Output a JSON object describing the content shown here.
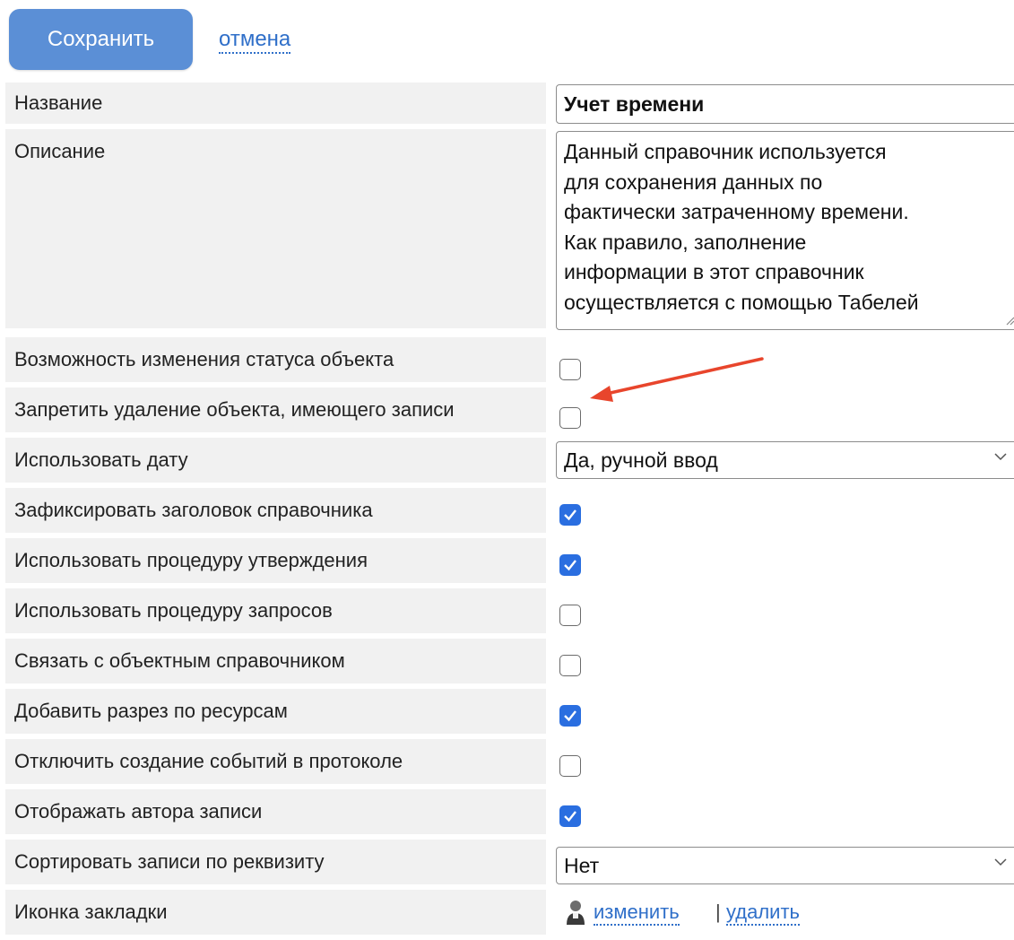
{
  "toolbar": {
    "save_label": "Сохранить",
    "cancel_label": "отмена"
  },
  "fields": {
    "name": {
      "label": "Название",
      "value": "Учет времени"
    },
    "description": {
      "label": "Описание",
      "lines": [
        "Данный справочник используется",
        "для сохранения данных по",
        "фактически затраченному времени.",
        "Как правило, заполнение",
        "информации в этот справочник",
        "осуществляется с помощью Табелей"
      ]
    },
    "status_change": {
      "label": "Возможность изменения статуса объекта",
      "checked": false
    },
    "forbid_delete": {
      "label": "Запретить удаление объекта, имеющего записи",
      "checked": false
    },
    "use_date": {
      "label": "Использовать дату",
      "value": "Да, ручной ввод"
    },
    "fix_header": {
      "label": "Зафиксировать заголовок справочника",
      "checked": true
    },
    "approval": {
      "label": "Использовать процедуру утверждения",
      "checked": true
    },
    "requests": {
      "label": "Использовать процедуру запросов",
      "checked": false
    },
    "link_object": {
      "label": "Связать с объектным справочником",
      "checked": false
    },
    "resources": {
      "label": "Добавить разрез по ресурсам",
      "checked": true
    },
    "disable_events": {
      "label": "Отключить создание событий в протоколе",
      "checked": false
    },
    "show_author": {
      "label": "Отображать автора записи",
      "checked": true
    },
    "sort_by": {
      "label": "Сортировать записи по реквизиту",
      "value": "Нет"
    },
    "tab_icon": {
      "label": "Иконка закладки",
      "change_label": "изменить",
      "separator": "|",
      "delete_label": "удалить"
    }
  },
  "colors": {
    "accent": "#5b8fd6",
    "link": "#2f6fc9",
    "checked": "#2a6ee0",
    "annotation_arrow": "#e8452c",
    "label_bg": "#f1f1f1"
  },
  "icons": {
    "tab_icon": "user-icon",
    "dropdown": "chevron-down-icon",
    "annotation": "arrow-annotation"
  }
}
